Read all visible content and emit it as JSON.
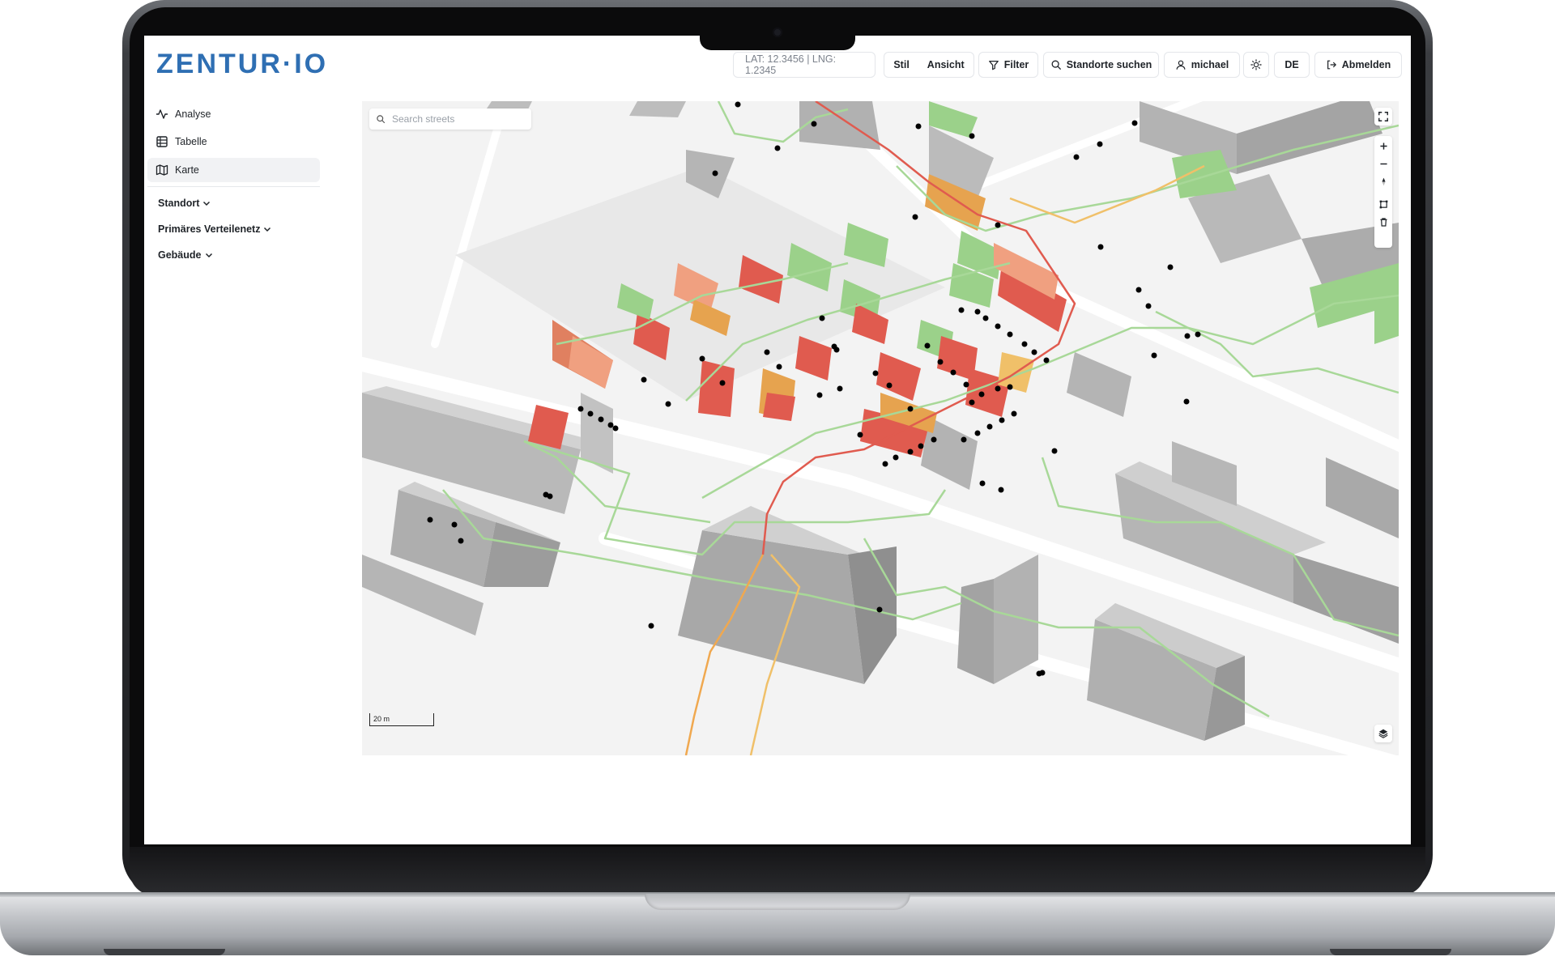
{
  "app": {
    "logo_text": "ZENTUR·IO",
    "brand_color": "#2f6fb3"
  },
  "header": {
    "coords": "LAT: 12.3456 |  LNG: 1.2345",
    "style_label": "Stil",
    "view_label": "Ansicht",
    "filter_label": "Filter",
    "search_locations_label": "Standorte suchen",
    "user_label": "michael",
    "theme_icon": "sun-icon",
    "language_label": "DE",
    "logout_label": "Abmelden"
  },
  "sidebar": {
    "items": [
      {
        "label": "Analyse",
        "icon": "activity-icon"
      },
      {
        "label": "Tabelle",
        "icon": "table-icon"
      },
      {
        "label": "Karte",
        "icon": "map-icon",
        "active": true
      }
    ],
    "sections": [
      {
        "label": "Standort",
        "icon": "chevron-down-icon"
      },
      {
        "label": "Primäres Verteilenetz",
        "icon": "chevron-down-icon"
      },
      {
        "label": "Gebäude",
        "icon": "chevron-down-icon"
      }
    ]
  },
  "map": {
    "search_placeholder": "Search streets",
    "scale_label": "20 m",
    "controls": [
      "fullscreen-icon",
      "zoom-in-icon",
      "zoom-out-icon",
      "compass-icon",
      "draw-polygon-icon",
      "trash-icon",
      "layers-icon"
    ],
    "colors": {
      "good": "#8fca7f",
      "warning": "#f0c069",
      "critical": "#e05b4f",
      "building": "#bdbdbd"
    }
  }
}
